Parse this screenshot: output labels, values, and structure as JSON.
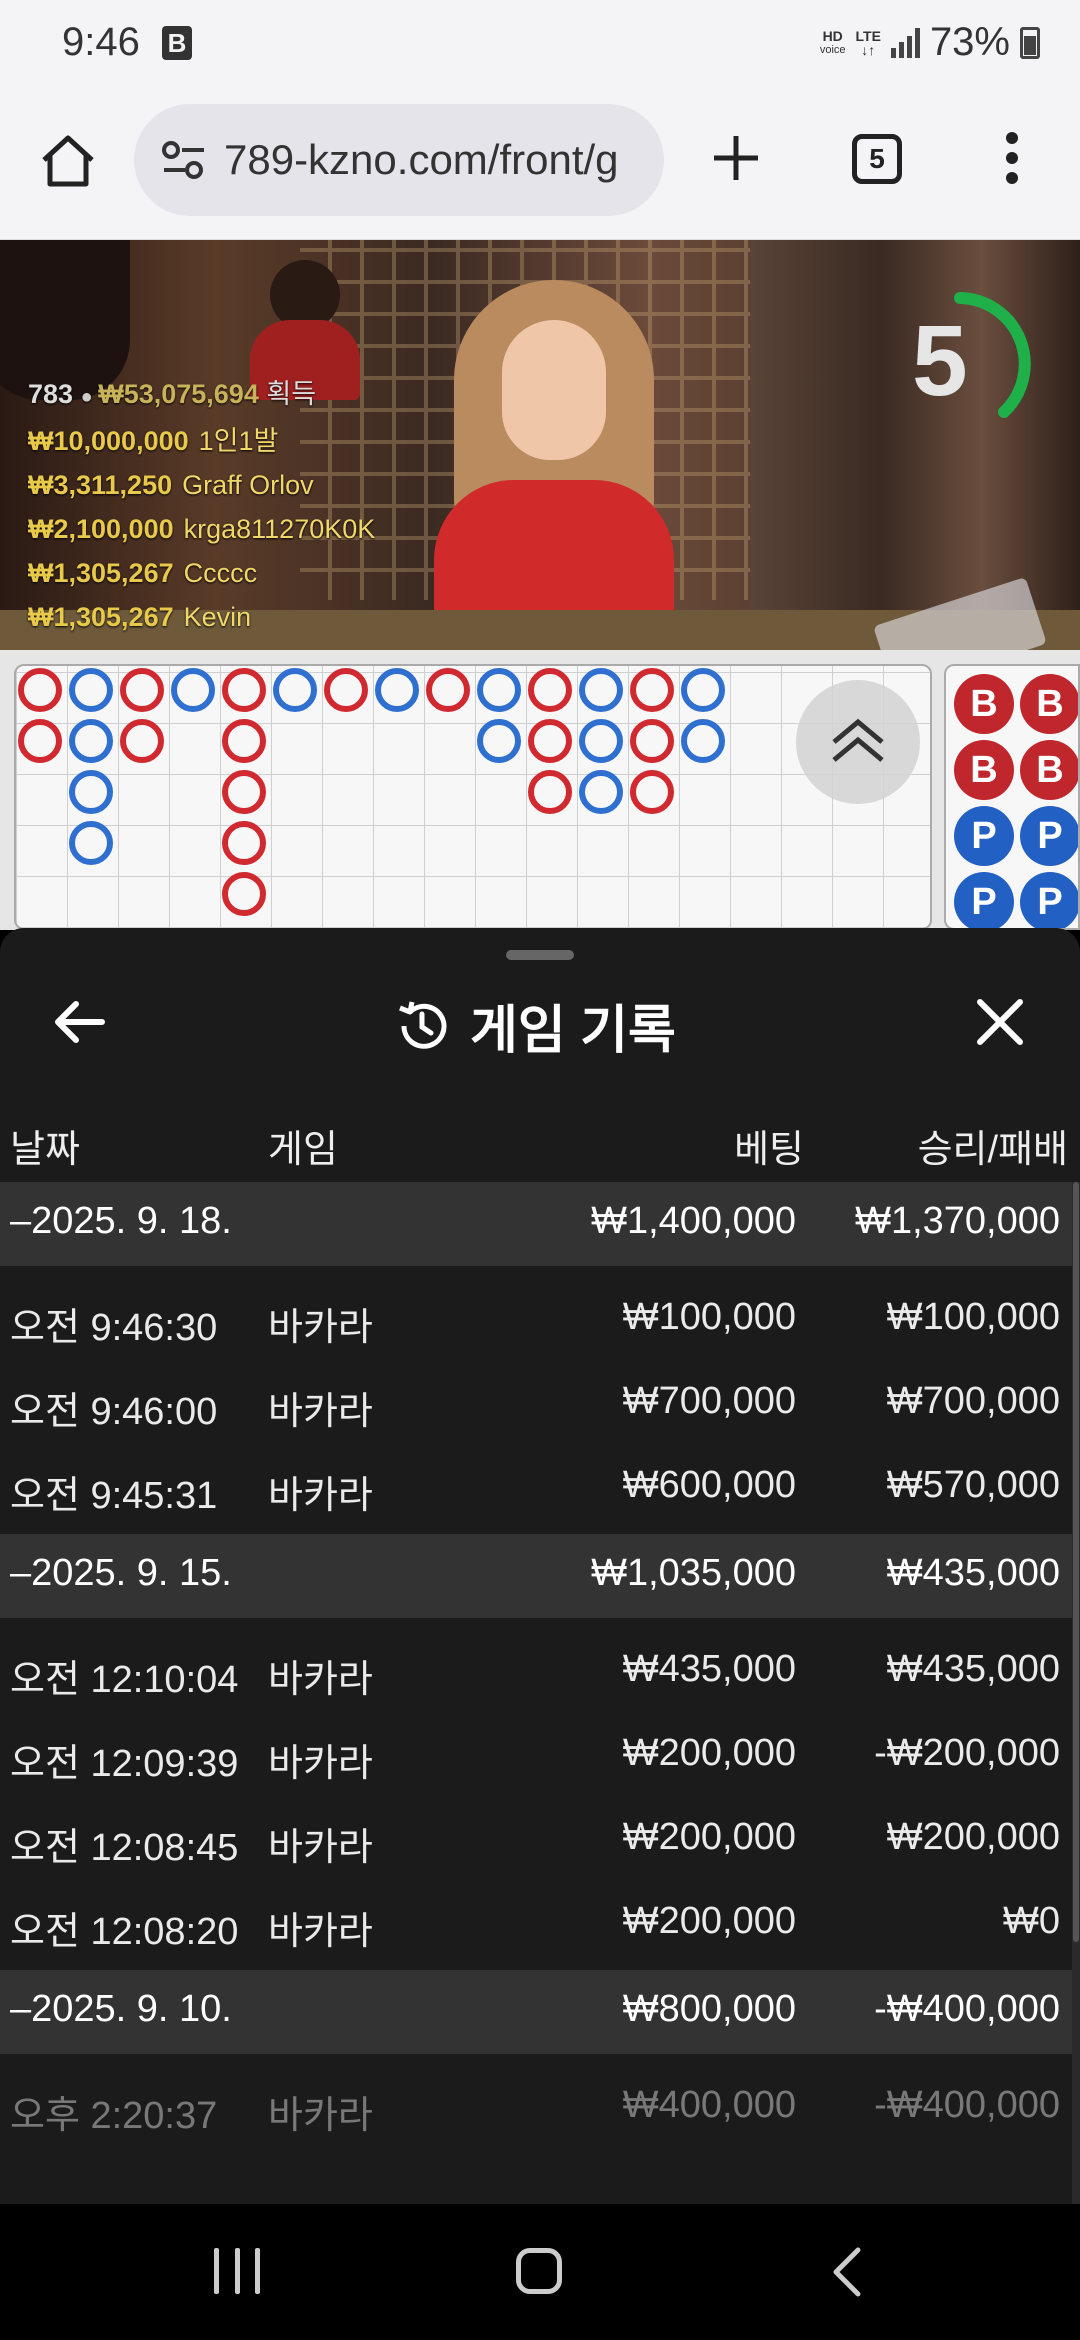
{
  "status_bar": {
    "time": "9:46",
    "app_badge": "B",
    "hd_voice": "HD",
    "hd_voice_sub": "voice",
    "network": "LTE",
    "battery": "73%"
  },
  "browser": {
    "url": "789-kzno.com/front/g",
    "tab_count": "5"
  },
  "live_stats": {
    "player_count": "783",
    "total_won": "₩53,075,694",
    "total_label": "획득",
    "winners": [
      {
        "amount": "₩10,000,000",
        "name": "1인1발"
      },
      {
        "amount": "₩3,311,250",
        "name": "Graff Orlov"
      },
      {
        "amount": "₩2,100,000",
        "name": "krga811270K0K"
      },
      {
        "amount": "₩1,305,267",
        "name": "Ccccc"
      },
      {
        "amount": "₩1,305,267",
        "name": "Kevin"
      }
    ],
    "countdown": "5"
  },
  "bead_road": {
    "labels": [
      "B",
      "B",
      "B",
      "B",
      "P",
      "P",
      "P",
      "P"
    ]
  },
  "sheet": {
    "title": "게임 기록",
    "columns": {
      "date": "날짜",
      "game": "게임",
      "bet": "베팅",
      "winloss": "승리/패배"
    },
    "groups": [
      {
        "date": "–2025. 9. 18.",
        "bet": "₩1,400,000",
        "winloss": "₩1,370,000",
        "rows": [
          {
            "time": "오전 9:46:30",
            "game": "바카라",
            "bet": "₩100,000",
            "winloss": "₩100,000"
          },
          {
            "time": "오전 9:46:00",
            "game": "바카라",
            "bet": "₩700,000",
            "winloss": "₩700,000"
          },
          {
            "time": "오전 9:45:31",
            "game": "바카라",
            "bet": "₩600,000",
            "winloss": "₩570,000"
          }
        ]
      },
      {
        "date": "–2025. 9. 15.",
        "bet": "₩1,035,000",
        "winloss": "₩435,000",
        "rows": [
          {
            "time": "오전 12:10:04",
            "game": "바카라",
            "bet": "₩435,000",
            "winloss": "₩435,000"
          },
          {
            "time": "오전 12:09:39",
            "game": "바카라",
            "bet": "₩200,000",
            "winloss": "-₩200,000"
          },
          {
            "time": "오전 12:08:45",
            "game": "바카라",
            "bet": "₩200,000",
            "winloss": "₩200,000"
          },
          {
            "time": "오전 12:08:20",
            "game": "바카라",
            "bet": "₩200,000",
            "winloss": "₩0"
          }
        ]
      },
      {
        "date": "–2025. 9. 10.",
        "bet": "₩800,000",
        "winloss": "-₩400,000",
        "rows": [
          {
            "time": "오후 2:20:37",
            "game": "바카라",
            "bet": "₩400,000",
            "winloss": "-₩400,000"
          }
        ]
      }
    ]
  },
  "colors": {
    "banker": "#d02a30",
    "player": "#2f6fd0",
    "gold_text": "#e8c94a",
    "sheet_bg": "#1b1b1b",
    "group_bg": "#333333"
  }
}
